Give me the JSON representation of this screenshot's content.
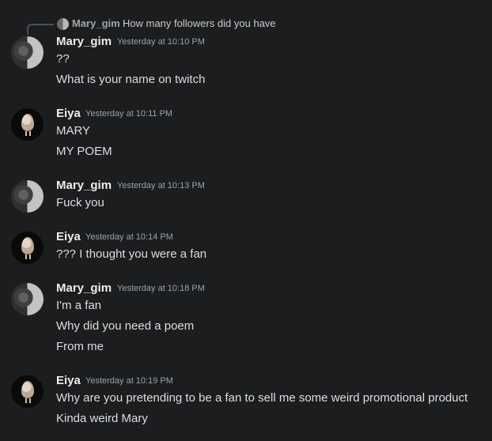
{
  "reply": {
    "author": "Mary_gim",
    "text": "How many followers did you have"
  },
  "messages": [
    {
      "author": "Mary_gim",
      "timestamp": "Yesterday at 10:10 PM",
      "lines": [
        "??",
        "What is your name on twitch"
      ]
    },
    {
      "author": "Eiya",
      "timestamp": "Yesterday at 10:11 PM",
      "lines": [
        "MARY",
        "MY POEM"
      ]
    },
    {
      "author": "Mary_gim",
      "timestamp": "Yesterday at 10:13 PM",
      "lines": [
        "Fuck you"
      ]
    },
    {
      "author": "Eiya",
      "timestamp": "Yesterday at 10:14 PM",
      "lines": [
        "??? I thought you were a fan"
      ]
    },
    {
      "author": "Mary_gim",
      "timestamp": "Yesterday at 10:18 PM",
      "lines": [
        "I'm a fan",
        "Why did you need a poem",
        "From me"
      ]
    },
    {
      "author": "Eiya",
      "timestamp": "Yesterday at 10:19 PM",
      "lines": [
        "Why are you pretending to be a fan to sell me some weird promotional product",
        "Kinda weird Mary"
      ]
    }
  ]
}
